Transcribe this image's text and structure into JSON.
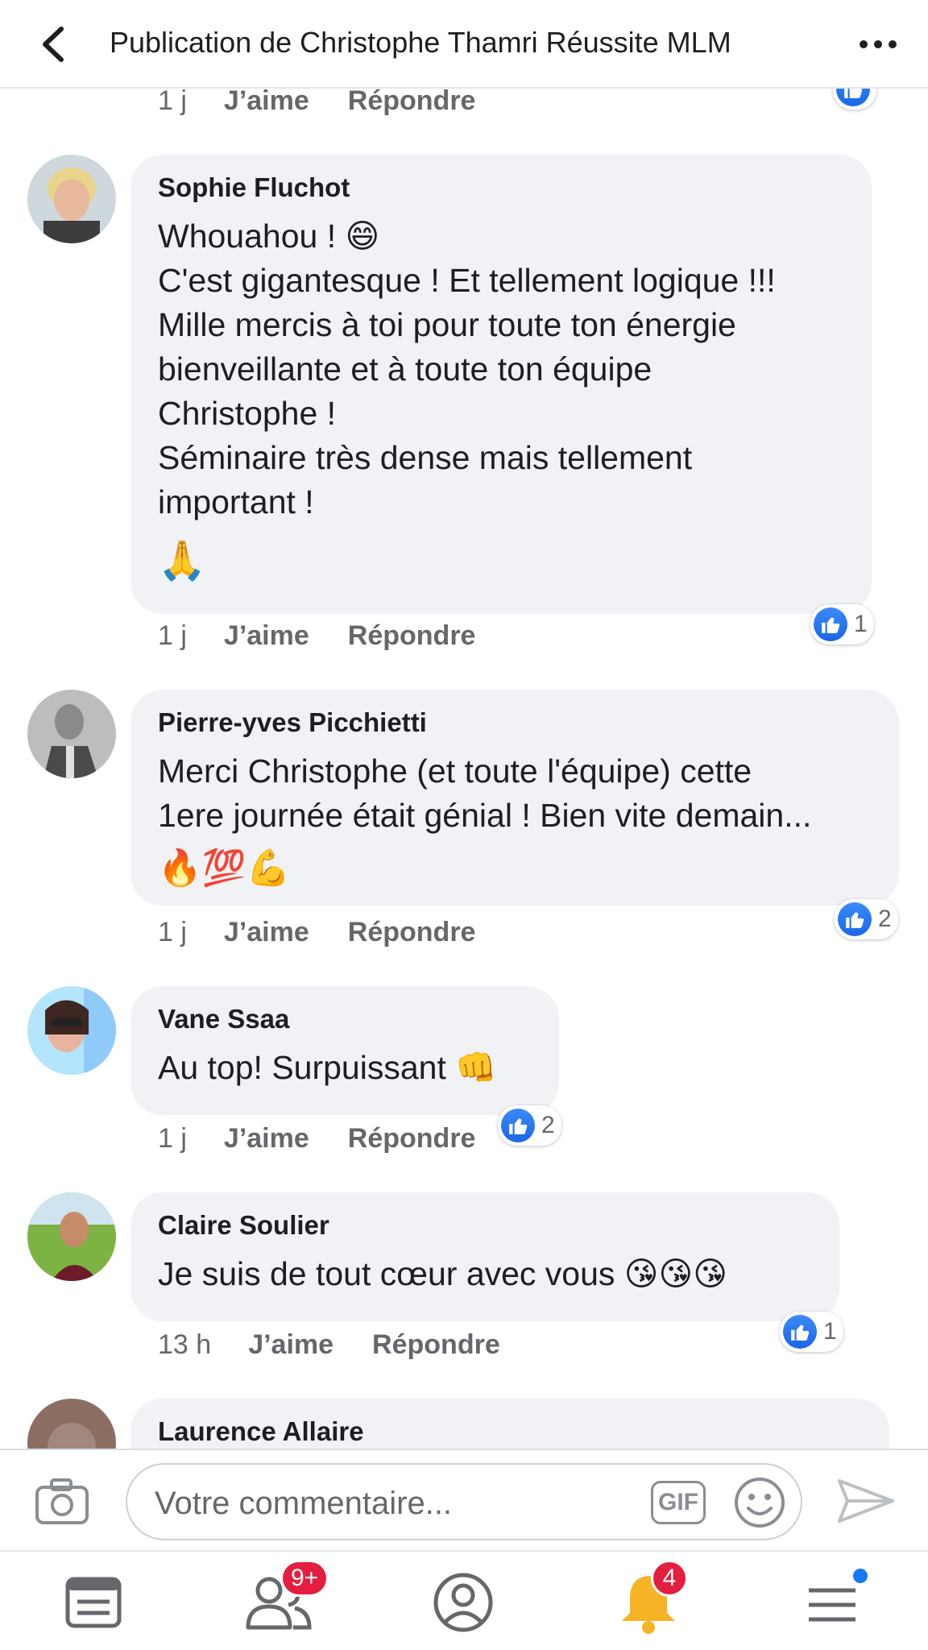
{
  "header": {
    "title": "Publication de Christophe Thamri Réussite MLM"
  },
  "top_meta": {
    "time": "1 j",
    "like": "J’aime",
    "reply": "Répondre"
  },
  "comments": [
    {
      "author": "Sophie Fluchot",
      "text": "Whouahou ! 😄\nC'est gigantesque ! Et tellement logique !!!\nMille mercis à toi pour toute ton  énergie\nbienveillante et à  toute ton équipe\nChristophe !\nSéminaire très dense mais tellement\nimportant !",
      "emoji_line": "🙏",
      "time": "1 j",
      "like": "J’aime",
      "reply": "Répondre",
      "likes": "1"
    },
    {
      "author": "Pierre-yves Picchietti",
      "text": "Merci Christophe (et toute l'équipe) cette\n1ere journée était génial ! Bien vite demain...",
      "emoji_line": "🔥💯💪",
      "time": "1 j",
      "like": "J’aime",
      "reply": "Répondre",
      "likes": "2"
    },
    {
      "author": "Vane Ssaa",
      "text": "Au top! Surpuissant 👊",
      "time": "1 j",
      "like": "J’aime",
      "reply": "Répondre",
      "likes": "2"
    },
    {
      "author": "Claire Soulier",
      "text": "Je suis de tout cœur avec vous 😘😘😘",
      "time": "13 h",
      "like": "J’aime",
      "reply": "Répondre",
      "likes": "1"
    },
    {
      "author": "Laurence Allaire"
    }
  ],
  "composer": {
    "placeholder": "Votre commentaire...",
    "gif_label": "GIF"
  },
  "tabbar": {
    "friends_badge": "9+",
    "notifications_badge": "4"
  },
  "colors": {
    "like_blue": "#1877f2",
    "badge_red": "#e41e3f",
    "bubble_bg": "#f0f2f5"
  },
  "icons": [
    "back-arrow-icon",
    "more-dots-icon",
    "thumbs-up-icon",
    "camera-icon",
    "smiley-icon",
    "send-icon",
    "news-feed-icon",
    "friends-icon",
    "profile-icon",
    "bell-icon",
    "menu-icon"
  ]
}
